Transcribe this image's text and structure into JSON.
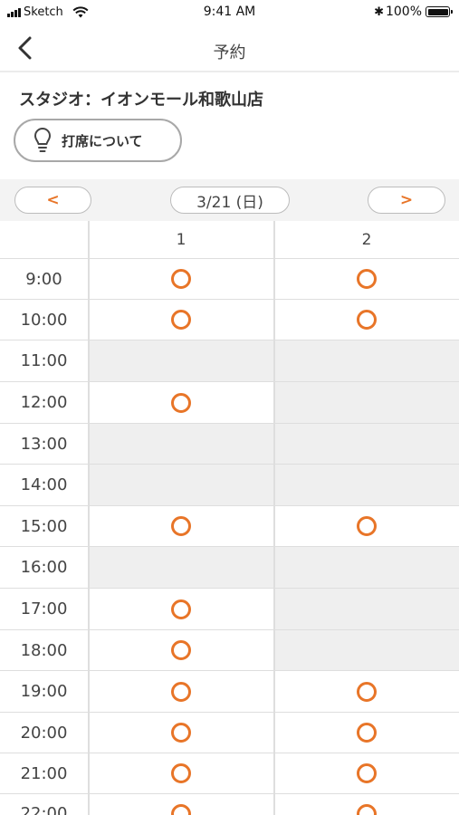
{
  "status_bar": {
    "carrier": "Sketch",
    "time": "9:41 AM",
    "battery": "100%",
    "bluetooth": "bluetooth-icon"
  },
  "nav": {
    "title": "予約",
    "back_icon": "chevron-left-icon"
  },
  "studio": {
    "label": "スタジオ：イオンモール和歌山店"
  },
  "about_button": {
    "label": "打席について",
    "icon": "lightbulb-icon"
  },
  "date_bar": {
    "prev_label": "<",
    "next_label": ">",
    "date": "3/21 (日)"
  },
  "accent_color": "#e87528",
  "columns": [
    "1",
    "2"
  ],
  "rows": [
    {
      "time": "9:00",
      "slots": [
        true,
        true
      ]
    },
    {
      "time": "10:00",
      "slots": [
        true,
        true
      ]
    },
    {
      "time": "11:00",
      "slots": [
        false,
        false
      ]
    },
    {
      "time": "12:00",
      "slots": [
        true,
        false
      ]
    },
    {
      "time": "13:00",
      "slots": [
        false,
        false
      ]
    },
    {
      "time": "14:00",
      "slots": [
        false,
        false
      ]
    },
    {
      "time": "15:00",
      "slots": [
        true,
        true
      ]
    },
    {
      "time": "16:00",
      "slots": [
        false,
        false
      ]
    },
    {
      "time": "17:00",
      "slots": [
        true,
        false
      ]
    },
    {
      "time": "18:00",
      "slots": [
        true,
        false
      ]
    },
    {
      "time": "19:00",
      "slots": [
        true,
        true
      ]
    },
    {
      "time": "20:00",
      "slots": [
        true,
        true
      ]
    },
    {
      "time": "21:00",
      "slots": [
        true,
        true
      ]
    },
    {
      "time": "22:00",
      "slots": [
        true,
        true
      ]
    }
  ]
}
